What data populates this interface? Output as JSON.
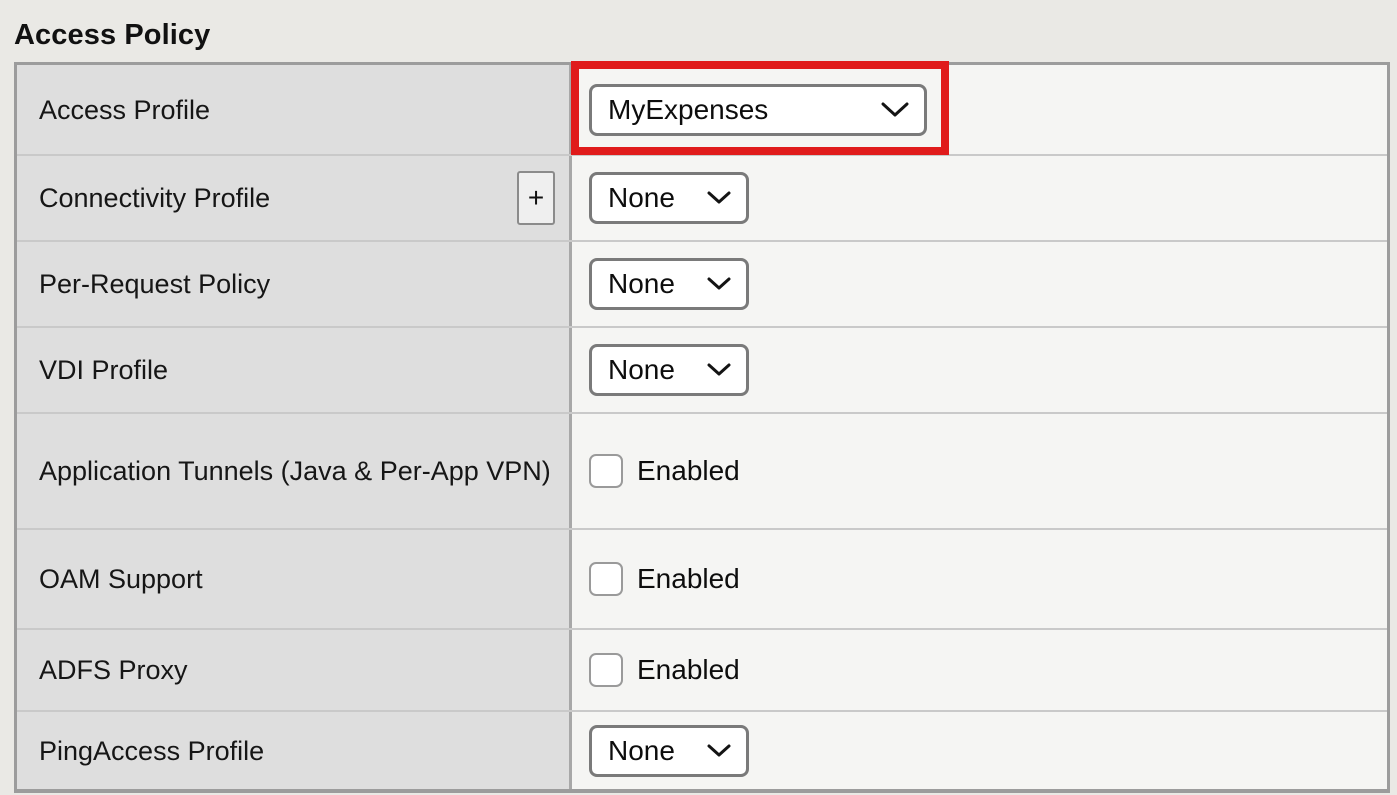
{
  "page": {
    "title": "Access Policy"
  },
  "highlight": {
    "color": "#e01b1b",
    "target": "access-profile-select"
  },
  "colors": {
    "page_background": "#eae9e5",
    "label_cell_background": "#dedede",
    "value_cell_background": "#f5f5f3",
    "table_border": "#9c9c9c",
    "row_divider": "#c9c9c9",
    "highlight_red": "#e01b1b"
  },
  "table": {
    "rows": [
      {
        "label": "Access Profile",
        "control": "select",
        "value": "MyExpenses",
        "has_plus": false,
        "highlighted": true
      },
      {
        "label": "Connectivity Profile",
        "control": "select",
        "value": "None",
        "has_plus": true,
        "plus_label": "+",
        "highlighted": false
      },
      {
        "label": "Per-Request Policy",
        "control": "select",
        "value": "None",
        "has_plus": false,
        "highlighted": false
      },
      {
        "label": "VDI Profile",
        "control": "select",
        "value": "None",
        "has_plus": false,
        "highlighted": false
      },
      {
        "label": "Application Tunnels (Java & Per-App VPN)",
        "control": "checkbox",
        "value": "Enabled",
        "checked": false,
        "has_plus": false,
        "highlighted": false
      },
      {
        "label": "OAM Support",
        "control": "checkbox",
        "value": "Enabled",
        "checked": false,
        "has_plus": false,
        "highlighted": false
      },
      {
        "label": "ADFS Proxy",
        "control": "checkbox",
        "value": "Enabled",
        "checked": false,
        "has_plus": false,
        "highlighted": false
      },
      {
        "label": "PingAccess Profile",
        "control": "select",
        "value": "None",
        "has_plus": false,
        "highlighted": false
      }
    ]
  }
}
